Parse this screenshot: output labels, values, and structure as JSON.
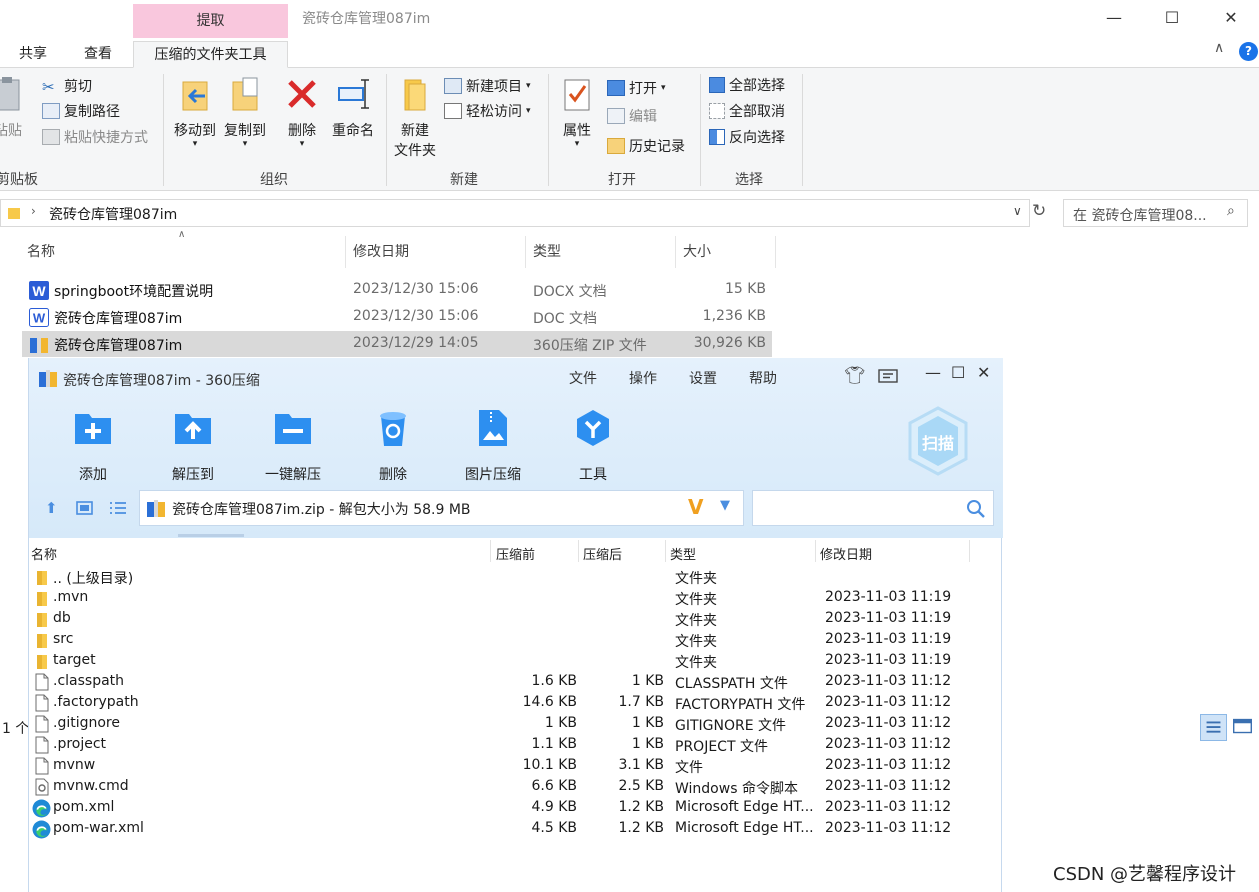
{
  "explorer": {
    "context_tab": "提取",
    "window_title": "瓷砖仓库管理087im",
    "tabs": [
      "共享",
      "查看",
      "压缩的文件夹工具"
    ],
    "clipboard": {
      "paste": "粘贴",
      "cut": "剪切",
      "copy_path": "复制路径",
      "paste_shortcut": "粘贴快捷方式",
      "label": "剪贴板"
    },
    "organize": {
      "move_to": "移动到",
      "copy_to": "复制到",
      "delete": "删除",
      "rename": "重命名",
      "label": "组织"
    },
    "new": {
      "new_folder_line1": "新建",
      "new_folder_line2": "文件夹",
      "new_item": "新建项目",
      "easy_access": "轻松访问",
      "label": "新建"
    },
    "open": {
      "properties": "属性",
      "open": "打开",
      "edit": "编辑",
      "history": "历史记录",
      "label": "打开"
    },
    "select": {
      "select_all": "全部选择",
      "select_none": "全部取消",
      "invert": "反向选择",
      "label": "选择"
    },
    "address": {
      "path": "瓷砖仓库管理087im",
      "search_placeholder": "在 瓷砖仓库管理08..."
    },
    "columns": {
      "name": "名称",
      "date": "修改日期",
      "type": "类型",
      "size": "大小"
    },
    "files": [
      {
        "name": "springboot环境配置说明",
        "date": "2023/12/30 15:06",
        "type": "DOCX 文档",
        "size": "15 KB",
        "icon": "word-icon"
      },
      {
        "name": "瓷砖仓库管理087im",
        "date": "2023/12/30 15:06",
        "type": "DOC 文档",
        "size": "1,236 KB",
        "icon": "doc-icon"
      },
      {
        "name": "瓷砖仓库管理087im",
        "date": "2023/12/29 14:05",
        "type": "360压缩 ZIP 文件",
        "size": "30,926 KB",
        "icon": "zip-icon"
      }
    ],
    "status": "1 个"
  },
  "zip": {
    "title": "瓷砖仓库管理087im - 360压缩",
    "menu": [
      "文件",
      "操作",
      "设置",
      "帮助"
    ],
    "tools": [
      "添加",
      "解压到",
      "一键解压",
      "删除",
      "图片压缩",
      "工具"
    ],
    "scan": "扫描",
    "path": "瓷砖仓库管理087im.zip - 解包大小为 58.9 MB",
    "columns": {
      "name": "名称",
      "before": "压缩前",
      "after": "压缩后",
      "type": "类型",
      "date": "修改日期"
    },
    "rows": [
      {
        "name": ".. (上级目录)",
        "before": "",
        "after": "",
        "type": "文件夹",
        "date": "",
        "icon": "folder-icon"
      },
      {
        "name": ".mvn",
        "before": "",
        "after": "",
        "type": "文件夹",
        "date": "2023-11-03 11:19",
        "icon": "folder-icon"
      },
      {
        "name": "db",
        "before": "",
        "after": "",
        "type": "文件夹",
        "date": "2023-11-03 11:19",
        "icon": "folder-icon"
      },
      {
        "name": "src",
        "before": "",
        "after": "",
        "type": "文件夹",
        "date": "2023-11-03 11:19",
        "icon": "folder-icon"
      },
      {
        "name": "target",
        "before": "",
        "after": "",
        "type": "文件夹",
        "date": "2023-11-03 11:19",
        "icon": "folder-icon"
      },
      {
        "name": ".classpath",
        "before": "1.6 KB",
        "after": "1 KB",
        "type": "CLASSPATH 文件",
        "date": "2023-11-03 11:12",
        "icon": "file-icon"
      },
      {
        "name": ".factorypath",
        "before": "14.6 KB",
        "after": "1.7 KB",
        "type": "FACTORYPATH 文件",
        "date": "2023-11-03 11:12",
        "icon": "file-icon"
      },
      {
        "name": ".gitignore",
        "before": "1 KB",
        "after": "1 KB",
        "type": "GITIGNORE 文件",
        "date": "2023-11-03 11:12",
        "icon": "file-icon"
      },
      {
        "name": ".project",
        "before": "1.1 KB",
        "after": "1 KB",
        "type": "PROJECT 文件",
        "date": "2023-11-03 11:12",
        "icon": "file-icon"
      },
      {
        "name": "mvnw",
        "before": "10.1 KB",
        "after": "3.1 KB",
        "type": "文件",
        "date": "2023-11-03 11:12",
        "icon": "file-icon"
      },
      {
        "name": "mvnw.cmd",
        "before": "6.6 KB",
        "after": "2.5 KB",
        "type": "Windows 命令脚本",
        "date": "2023-11-03 11:12",
        "icon": "cmd-icon"
      },
      {
        "name": "pom.xml",
        "before": "4.9 KB",
        "after": "1.2 KB",
        "type": "Microsoft Edge HT...",
        "date": "2023-11-03 11:12",
        "icon": "edge-icon"
      },
      {
        "name": "pom-war.xml",
        "before": "4.5 KB",
        "after": "1.2 KB",
        "type": "Microsoft Edge HT...",
        "date": "2023-11-03 11:12",
        "icon": "edge-icon"
      }
    ]
  },
  "watermark": "CSDN @艺馨程序设计"
}
